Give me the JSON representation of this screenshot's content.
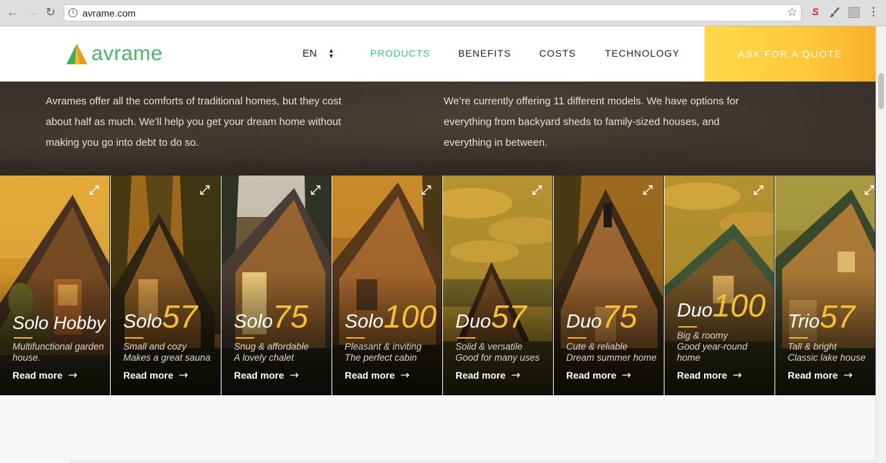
{
  "browser": {
    "url": "avrame.com",
    "icons": [
      "back-arrow-icon",
      "forward-arrow-icon",
      "reload-icon",
      "info-icon",
      "bookmark-star-icon",
      "extension-icon",
      "brush-extension-icon",
      "menu-icon"
    ]
  },
  "header": {
    "logo_text": "avrame",
    "language": "EN",
    "nav": [
      {
        "label": "PRODUCTS",
        "active": true
      },
      {
        "label": "BENEFITS",
        "active": false
      },
      {
        "label": "COSTS",
        "active": false
      },
      {
        "label": "TECHNOLOGY",
        "active": false
      }
    ],
    "cta_label": "ASK FOR A QUOTE",
    "colors": {
      "brand_green": "#48b46a",
      "active_nav": "#36c18d",
      "cta_yellow": "#ffd84a"
    }
  },
  "intro": {
    "left_lines": [
      "Avrames offer all the comforts of traditional homes, but they cost",
      "about half as much. We’ll help you get your dream home without",
      "making you go into debt to do so."
    ],
    "right_lines": [
      "We’re currently offering 11 different models. We have options for",
      "everything from backyard sheds to family-sized houses, and",
      "everything in between."
    ]
  },
  "cards": [
    {
      "name": "Solo Hobby",
      "number": "",
      "desc": [
        "Multifunctional garden",
        "house."
      ],
      "read_more": "Read more"
    },
    {
      "name": "Solo",
      "number": "57",
      "desc": [
        "Small and cozy",
        "Makes a great sauna"
      ],
      "read_more": "Read more"
    },
    {
      "name": "Solo",
      "number": "75",
      "desc": [
        "Snug & affordable",
        "A lovely chalet"
      ],
      "read_more": "Read more"
    },
    {
      "name": "Solo",
      "number": "100",
      "desc": [
        "Pleasant & inviting",
        "The perfect cabin"
      ],
      "read_more": "Read more"
    },
    {
      "name": "Duo",
      "number": "57",
      "desc": [
        "Solid & versatile",
        "Good for many uses"
      ],
      "read_more": "Read more"
    },
    {
      "name": "Duo",
      "number": "75",
      "desc": [
        "Cute & reliable",
        "Dream summer home"
      ],
      "read_more": "Read more"
    },
    {
      "name": "Duo",
      "number": "100",
      "desc": [
        "Big & roomy",
        "Good year-round",
        "home"
      ],
      "read_more": "Read more"
    },
    {
      "name": "Trio",
      "number": "57",
      "desc": [
        "Tall & bright",
        "Classic lake house"
      ],
      "read_more": "Read more"
    }
  ]
}
